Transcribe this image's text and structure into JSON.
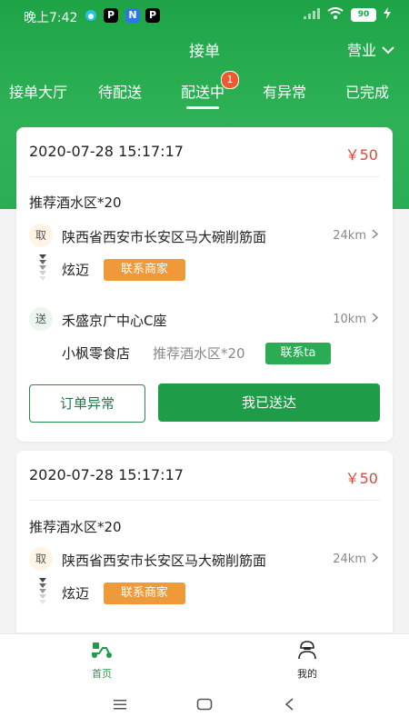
{
  "status_bar": {
    "time": "晚上7:42",
    "apps": [
      "P",
      "N",
      "P"
    ],
    "battery": "90"
  },
  "header": {
    "title": "接单",
    "business_status": "营业"
  },
  "tabs": [
    {
      "label": "接单大厅"
    },
    {
      "label": "待配送"
    },
    {
      "label": "配送中",
      "badge": "1"
    },
    {
      "label": "有异常"
    },
    {
      "label": "已完成"
    }
  ],
  "orders": [
    {
      "time": "2020-07-28 15:17:17",
      "price": "￥50",
      "product": "推荐酒水区*20",
      "pickup_tag": "取",
      "pickup_address": "陕西省西安市长安区马大碗削筋面",
      "pickup_distance": "24km",
      "pickup_name": "炫迈",
      "contact_shop": "联系商家",
      "deliver_tag": "送",
      "deliver_address": "禾盛京广中心C座",
      "deliver_distance": "10km",
      "deliver_name": "小枫零食店",
      "deliver_note": "推荐酒水区*20",
      "contact_ta": "联系ta",
      "btn_exception": "订单异常",
      "btn_delivered": "我已送达"
    },
    {
      "time": "2020-07-28 15:17:17",
      "price": "￥50",
      "product": "推荐酒水区*20",
      "pickup_tag": "取",
      "pickup_address": "陕西省西安市长安区马大碗削筋面",
      "pickup_distance": "24km",
      "pickup_name": "炫迈",
      "contact_shop": "联系商家"
    }
  ],
  "bottom_nav": [
    {
      "label": "首页",
      "icon": "scooter-icon",
      "active": true
    },
    {
      "label": "我的",
      "icon": "rider-icon",
      "active": false
    }
  ],
  "colors": {
    "brand_green": "#1ea446",
    "price_red": "#e0463c",
    "orange": "#ef9a3a",
    "badge": "#ee5a2c"
  }
}
